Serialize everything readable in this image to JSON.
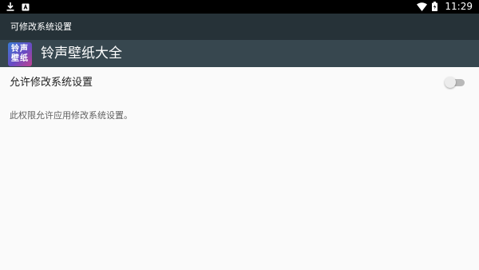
{
  "status_bar": {
    "time": "11:29",
    "left_icons": [
      "download-icon",
      "app-notification-icon"
    ],
    "right_icons": [
      "wifi-icon",
      "battery-icon"
    ]
  },
  "title_bar": {
    "title": "可修改系统设置"
  },
  "app_bar": {
    "icon_text_line1": "铃声",
    "icon_text_line2": "壁纸",
    "app_name": "铃声壁纸大全"
  },
  "setting": {
    "label": "允许修改系统设置",
    "toggle_state": "off",
    "description": "此权限允许应用修改系统设置。"
  },
  "colors": {
    "status_bar": "#000000",
    "title_bar": "#263238",
    "app_bar": "#37474f",
    "background": "#fafafa"
  }
}
